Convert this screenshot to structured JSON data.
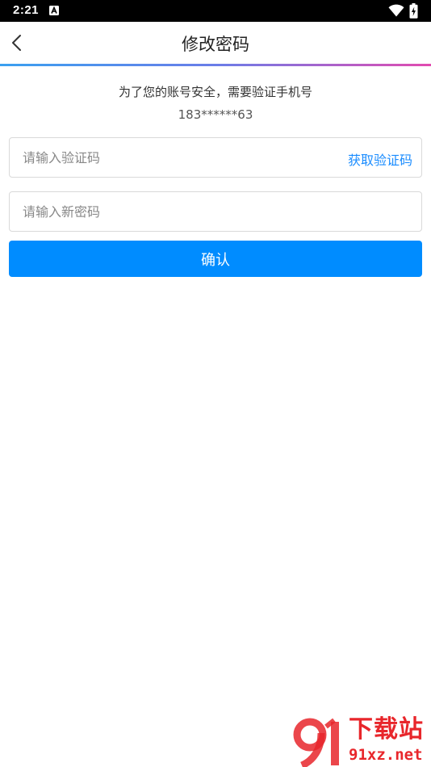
{
  "status_bar": {
    "time": "2:21",
    "icons": [
      "a-notification-icon",
      "wifi-icon",
      "battery-charging-icon"
    ]
  },
  "header": {
    "title": "修改密码",
    "back_icon": "chevron-left-icon"
  },
  "hint": {
    "text": "为了您的账号安全，需要验证手机号",
    "phone": "183******63"
  },
  "form": {
    "code_placeholder": "请输入验证码",
    "code_value": "",
    "get_code_label": "获取验证码",
    "password_placeholder": "请输入新密码",
    "password_value": "",
    "confirm_label": "确认"
  },
  "watermark": {
    "title": "下载站",
    "domain": "91xz.net"
  },
  "colors": {
    "accent": "#008cff",
    "link": "#1a8cff",
    "watermark": "#e8262b"
  }
}
